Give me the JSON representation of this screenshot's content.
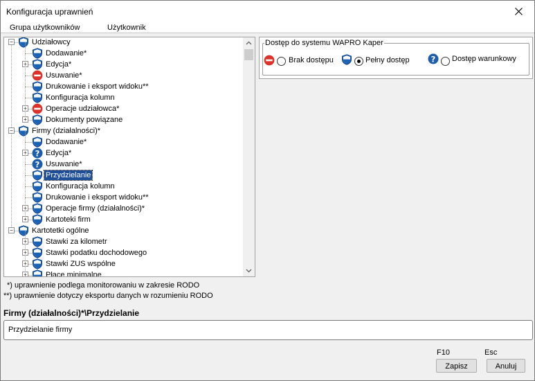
{
  "window": {
    "title": "Konfiguracja uprawnień"
  },
  "tabs": [
    "Grupa użytkowników",
    "Użytkownik"
  ],
  "tree": [
    {
      "label": "Udziałowcy",
      "level": 0,
      "expander": "minus",
      "icon": "shield"
    },
    {
      "label": "Dodawanie*",
      "level": 1,
      "expander": "none",
      "icon": "shield"
    },
    {
      "label": "Edycja*",
      "level": 1,
      "expander": "plus",
      "icon": "shield"
    },
    {
      "label": "Usuwanie*",
      "level": 1,
      "expander": "none",
      "icon": "deny"
    },
    {
      "label": "Drukowanie i eksport widoku**",
      "level": 1,
      "expander": "none",
      "icon": "shield"
    },
    {
      "label": "Konfiguracja kolumn",
      "level": 1,
      "expander": "none",
      "icon": "shield"
    },
    {
      "label": "Operacje udziałowca*",
      "level": 1,
      "expander": "plus",
      "icon": "deny"
    },
    {
      "label": "Dokumenty powiązane",
      "level": 1,
      "expander": "plus",
      "icon": "shield"
    },
    {
      "label": "Firmy (działalności)*",
      "level": 0,
      "expander": "minus",
      "icon": "shield"
    },
    {
      "label": "Dodawanie*",
      "level": 1,
      "expander": "none",
      "icon": "shield"
    },
    {
      "label": "Edycja*",
      "level": 1,
      "expander": "plus",
      "icon": "question"
    },
    {
      "label": "Usuwanie*",
      "level": 1,
      "expander": "none",
      "icon": "question"
    },
    {
      "label": "Przydzielanie",
      "level": 1,
      "expander": "none",
      "icon": "shield",
      "selected": true
    },
    {
      "label": "Konfiguracja kolumn",
      "level": 1,
      "expander": "none",
      "icon": "shield"
    },
    {
      "label": "Drukowanie i eksport widoku**",
      "level": 1,
      "expander": "none",
      "icon": "shield"
    },
    {
      "label": "Operacje firmy (działalności)*",
      "level": 1,
      "expander": "plus",
      "icon": "shield"
    },
    {
      "label": "Kartoteki firm",
      "level": 1,
      "expander": "plus",
      "icon": "shield"
    },
    {
      "label": "Kartotetki ogólne",
      "level": 0,
      "expander": "minus",
      "icon": "shield"
    },
    {
      "label": "Stawki za kilometr",
      "level": 1,
      "expander": "plus",
      "icon": "shield"
    },
    {
      "label": "Stawki podatku dochodowego",
      "level": 1,
      "expander": "plus",
      "icon": "shield"
    },
    {
      "label": "Stawki ZUS wspólne",
      "level": 1,
      "expander": "plus",
      "icon": "shield"
    },
    {
      "label": "Płace minimalne",
      "level": 1,
      "expander": "plus",
      "icon": "shield"
    }
  ],
  "notes": {
    "note1": "*) uprawnienie podlega monitorowaniu w zakresie RODO",
    "note2": "**) uprawnienie dotyczy eksportu danych w rozumieniu RODO"
  },
  "access": {
    "legend": "Dostęp do systemu WAPRO Kaper",
    "options": [
      {
        "label": "Brak dostępu",
        "icon": "deny",
        "selected": false
      },
      {
        "label": "Pełny dostęp",
        "icon": "shield",
        "selected": true
      },
      {
        "label": "Dostęp warunkowy",
        "icon": "question",
        "selected": false
      }
    ]
  },
  "selection": {
    "path": "Firmy (działalności)*\\Przydzielanie",
    "description": "Przydzielanie firmy"
  },
  "buttons": {
    "save_key": "F10",
    "save_label": "Zapisz",
    "cancel_key": "Esc",
    "cancel_label": "Anuluj"
  }
}
